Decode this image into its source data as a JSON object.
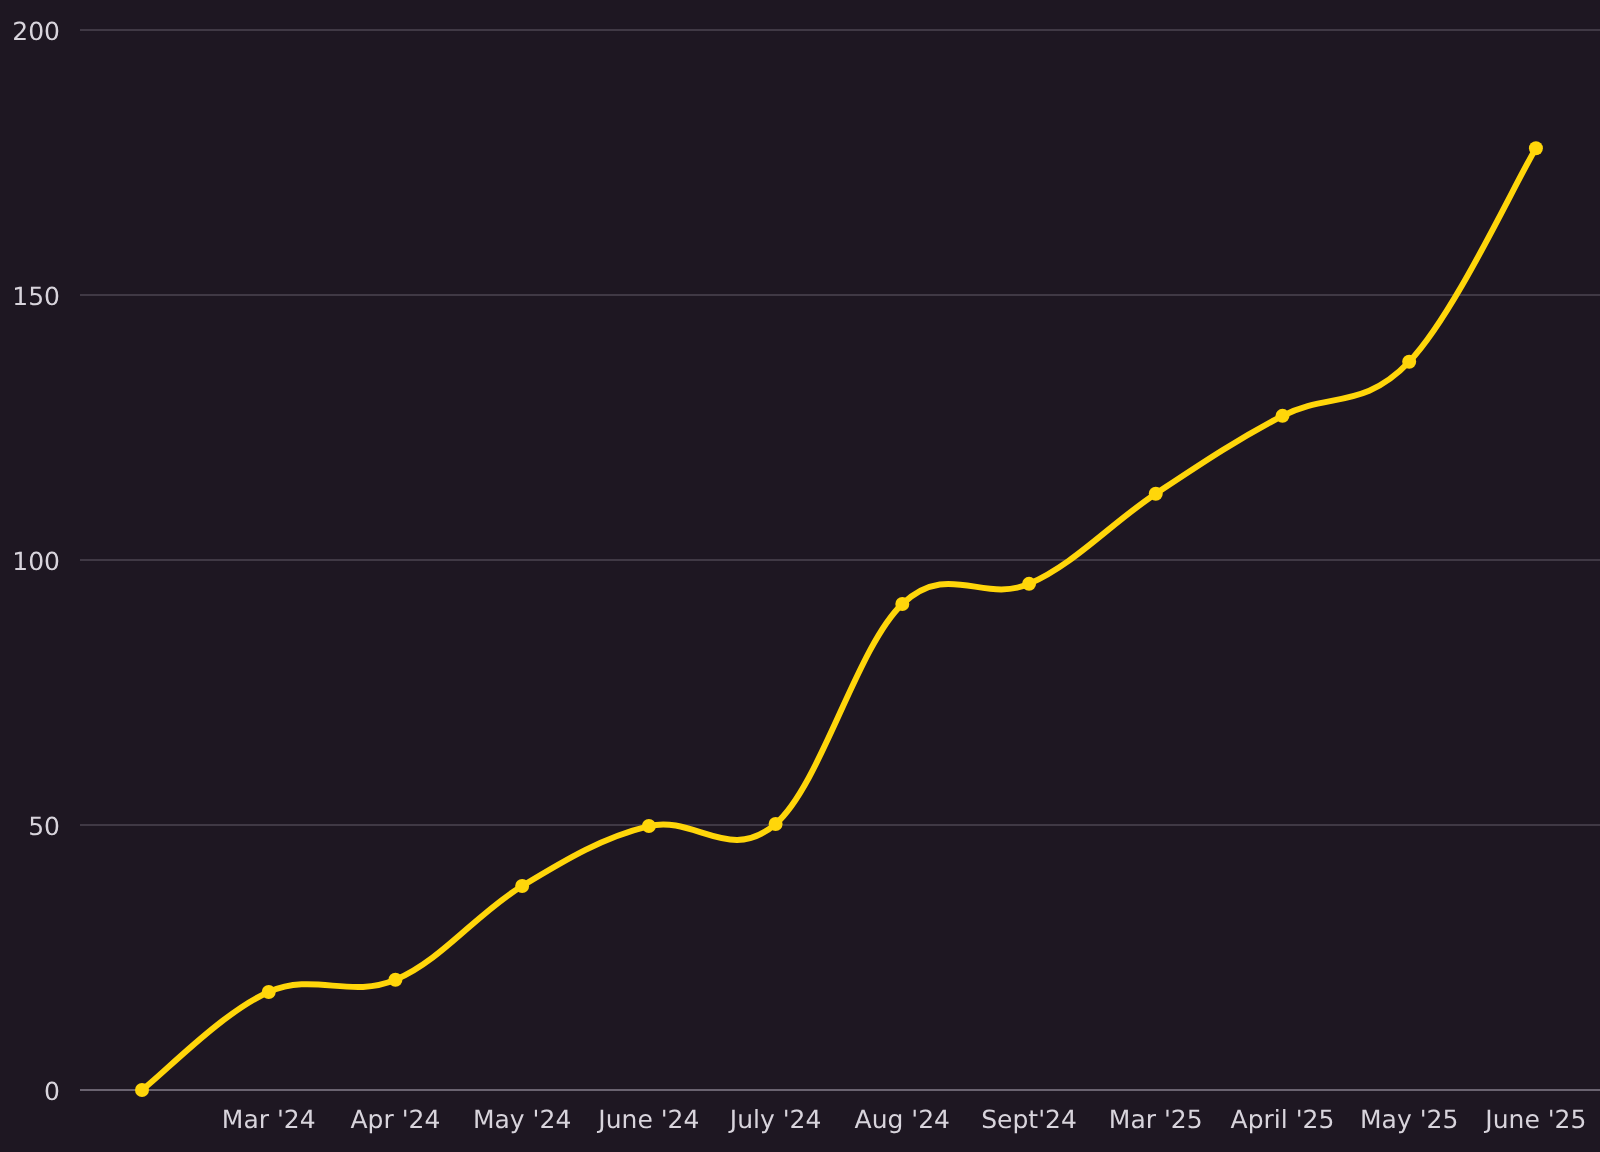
{
  "chart_data": {
    "type": "line",
    "categories": [
      null,
      "Mar '24",
      "Apr '24",
      "May '24",
      "June '24",
      "July '24",
      "Aug '24",
      "Sept'24",
      "Mar '25",
      "April '25",
      "May '25",
      "June '25"
    ],
    "grid": true,
    "series": [
      {
        "color": "#ffd60a",
        "marker": true,
        "values": [
          0,
          18.5,
          20.8,
          38.5,
          49.8,
          50.2,
          91.7,
          95.5,
          112.5,
          127.2,
          137.4,
          177.7
        ]
      }
    ],
    "ylim": [
      0,
      200
    ],
    "yticks": [
      0,
      50,
      100,
      150,
      200
    ]
  }
}
